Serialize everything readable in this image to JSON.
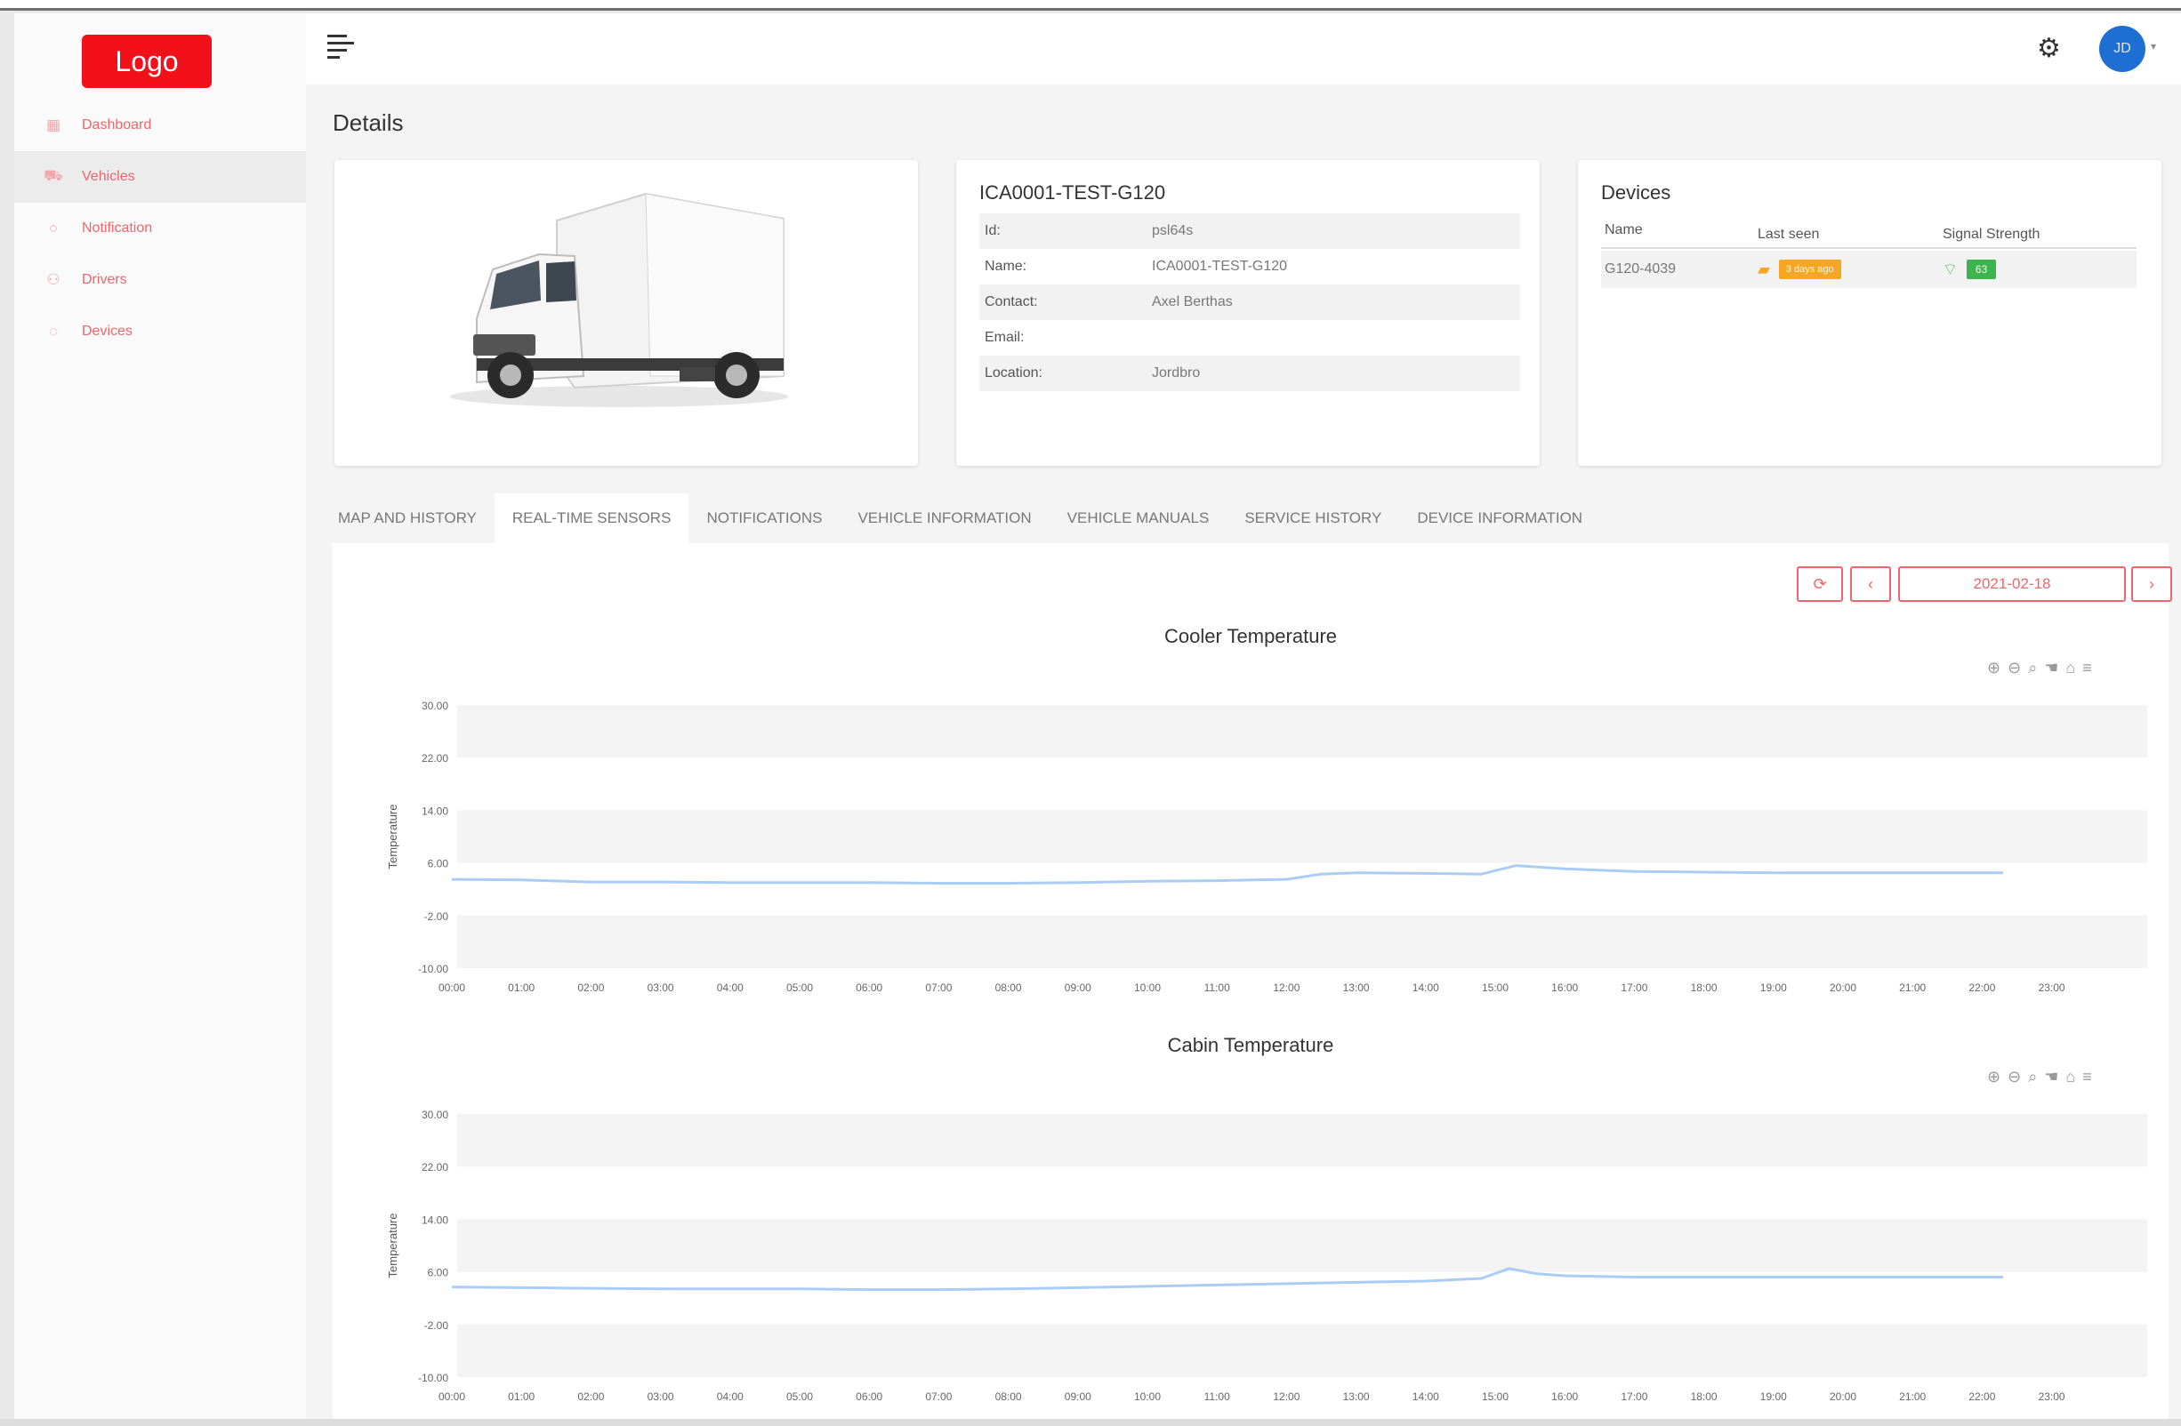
{
  "logo": {
    "text": "Logo"
  },
  "sidebar": {
    "items": [
      {
        "label": "Dashboard",
        "icon": "grid-icon"
      },
      {
        "label": "Vehicles",
        "icon": "truck-icon"
      },
      {
        "label": "Notification",
        "icon": "bell-icon"
      },
      {
        "label": "Drivers",
        "icon": "user-icon"
      },
      {
        "label": "Devices",
        "icon": "device-icon"
      }
    ]
  },
  "header": {
    "avatar_initials": "JD"
  },
  "page": {
    "title": "Details"
  },
  "vehicle": {
    "title": "ICA0001-TEST-G120",
    "details": [
      {
        "key": "Id:",
        "value": "psl64s"
      },
      {
        "key": "Name:",
        "value": "ICA0001-TEST-G120"
      },
      {
        "key": "Contact:",
        "value": "Axel Berthas"
      },
      {
        "key": "Email:",
        "value": ""
      },
      {
        "key": "Location:",
        "value": "Jordbro"
      }
    ]
  },
  "devices": {
    "title": "Devices",
    "columns": [
      "Name",
      "Last seen",
      "Signal Strength"
    ],
    "rows": [
      {
        "name": "G120-4039",
        "last_seen": "3 days ago",
        "signal": "63"
      }
    ]
  },
  "tabs": [
    "MAP AND HISTORY",
    "REAL-TIME SENSORS",
    "NOTIFICATIONS",
    "VEHICLE INFORMATION",
    "VEHICLE MANUALS",
    "SERVICE HISTORY",
    "DEVICE INFORMATION"
  ],
  "controls": {
    "date": "2021-02-18"
  },
  "colors": {
    "accent": "#f0646a",
    "logo": "#f2101a",
    "series": "#a9cdf5"
  },
  "chart_data": [
    {
      "type": "line",
      "title": "Cooler Temperature",
      "ylabel": "Temperature",
      "y_ticks": [
        "30.00",
        "22.00",
        "14.00",
        "6.00",
        "-2.00",
        "-10.00"
      ],
      "ylim": [
        -10,
        30
      ],
      "x_ticks": [
        "00:00",
        "01:00",
        "02:00",
        "03:00",
        "04:00",
        "05:00",
        "06:00",
        "07:00",
        "08:00",
        "09:00",
        "10:00",
        "11:00",
        "12:00",
        "13:00",
        "14:00",
        "15:00",
        "16:00",
        "17:00",
        "18:00",
        "19:00",
        "20:00",
        "21:00",
        "22:00",
        "23:00"
      ],
      "series": [
        {
          "x": [
            0,
            1,
            2,
            3,
            4,
            5,
            6,
            7,
            8,
            9,
            10,
            11,
            12,
            12.5,
            13,
            14,
            14.8,
            15.3,
            16,
            17,
            18,
            19,
            20,
            21,
            22.3
          ],
          "values": [
            3.5,
            3.4,
            3.1,
            3.1,
            3.0,
            3.0,
            3.0,
            2.9,
            2.9,
            3.0,
            3.2,
            3.3,
            3.5,
            4.3,
            4.5,
            4.4,
            4.3,
            5.6,
            5.1,
            4.7,
            4.6,
            4.5,
            4.5,
            4.5,
            4.5
          ]
        }
      ]
    },
    {
      "type": "line",
      "title": "Cabin Temperature",
      "ylabel": "Temperature",
      "y_ticks": [
        "30.00",
        "22.00",
        "14.00",
        "6.00",
        "-2.00",
        "-10.00"
      ],
      "ylim": [
        -10,
        30
      ],
      "x_ticks": [
        "00:00",
        "01:00",
        "02:00",
        "03:00",
        "04:00",
        "05:00",
        "06:00",
        "07:00",
        "08:00",
        "09:00",
        "10:00",
        "11:00",
        "12:00",
        "13:00",
        "14:00",
        "15:00",
        "16:00",
        "17:00",
        "18:00",
        "19:00",
        "20:00",
        "21:00",
        "22:00",
        "23:00"
      ],
      "series": [
        {
          "x": [
            0,
            1,
            2,
            3,
            4,
            5,
            6,
            7,
            8,
            9,
            10,
            11,
            12,
            13,
            14,
            14.8,
            15.2,
            15.6,
            16,
            17,
            18,
            19,
            20,
            21,
            22.3
          ],
          "values": [
            3.7,
            3.6,
            3.5,
            3.4,
            3.4,
            3.4,
            3.3,
            3.3,
            3.4,
            3.6,
            3.8,
            4.0,
            4.2,
            4.4,
            4.6,
            5.0,
            6.5,
            5.7,
            5.4,
            5.2,
            5.2,
            5.2,
            5.2,
            5.2,
            5.2
          ]
        }
      ]
    }
  ]
}
